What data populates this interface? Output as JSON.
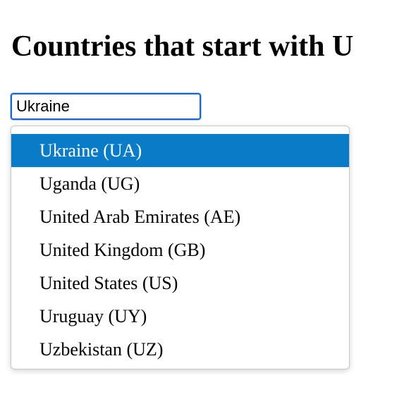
{
  "page": {
    "title": "Countries that start with U"
  },
  "search": {
    "value": "Ukraine"
  },
  "dropdown": {
    "selected_index": 0,
    "items": [
      {
        "label": "Ukraine (UA)"
      },
      {
        "label": "Uganda (UG)"
      },
      {
        "label": "United Arab Emirates (AE)"
      },
      {
        "label": "United Kingdom (GB)"
      },
      {
        "label": "United States (US)"
      },
      {
        "label": "Uruguay (UY)"
      },
      {
        "label": "Uzbekistan (UZ)"
      }
    ]
  },
  "colors": {
    "selected_background": "#0a7bc7",
    "input_focus_border": "#1a63d1"
  }
}
